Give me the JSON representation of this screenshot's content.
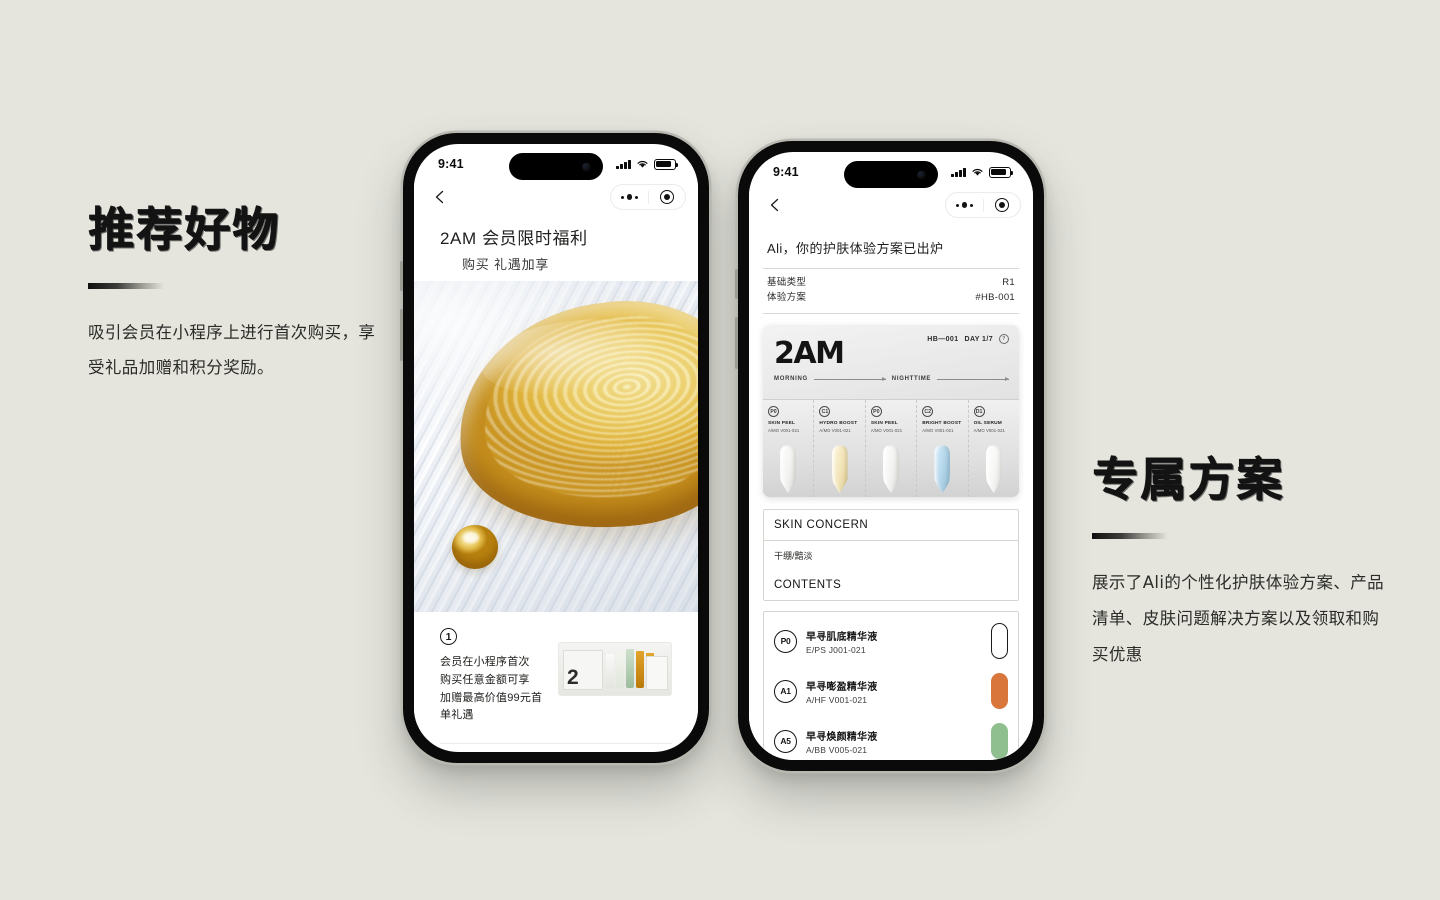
{
  "page": {
    "background_color": "#e5e5de",
    "accent_color": "#131313"
  },
  "left_block": {
    "heading": "推荐好物",
    "body": "吸引会员在小程序上进行首次购买，享受礼品加赠和积分奖励。"
  },
  "right_block": {
    "heading": "专属方案",
    "body": "展示了Ali的个性化护肤体验方案、产品清单、皮肤问题解决方案以及领取和购买优惠"
  },
  "phone1": {
    "status": {
      "time": "9:41",
      "signal_icon": "signal-bars-icon",
      "wifi_icon": "wifi-icon",
      "battery_icon": "battery-icon"
    },
    "nav": {
      "back_icon": "back-chevron-icon",
      "menu_icon": "more-dots-icon",
      "target_icon": "capsule-target-icon"
    },
    "header": {
      "title": "2AM 会员限时福利",
      "subtitle": "购买 礼遇加享"
    },
    "hero": {
      "name": "golden-oil-droplet-image"
    },
    "promo": {
      "badge": "1",
      "line1": "会员在小程序首次",
      "line2": "购买任意金额可享",
      "line3": "加赠最高价值99元首单礼遇",
      "thumb_name": "product-kit-thumbnail",
      "thumb_brand": "2AM"
    }
  },
  "phone2": {
    "status": {
      "time": "9:41",
      "signal_icon": "signal-bars-icon",
      "wifi_icon": "wifi-icon",
      "battery_icon": "battery-icon"
    },
    "nav": {
      "back_icon": "back-chevron-icon",
      "menu_icon": "more-dots-icon",
      "target_icon": "capsule-target-icon"
    },
    "title": "Ali，你的护肤体验方案已出炉",
    "meta": [
      {
        "label": "基础类型",
        "value": "R1"
      },
      {
        "label": "体验方案",
        "value": "#HB-001"
      }
    ],
    "kit": {
      "brand": "2AM",
      "code": "HB—001",
      "day": "DAY 1/7",
      "info_icon": "info-circle-icon",
      "phase_morning": "MORNING",
      "phase_night": "NIGHTTIME",
      "slots": [
        {
          "badge": "P0",
          "name": "SKIN PEEL",
          "code": "A/MO V001-021",
          "color": "#f7f7f5"
        },
        {
          "badge": "C1",
          "name": "HYDRO BOOST",
          "code": "A/MO V001-021",
          "color": "#f3e6bd"
        },
        {
          "badge": "P0",
          "name": "SKIN PEEL",
          "code": "A/MO V001-021",
          "color": "#f7f7f5"
        },
        {
          "badge": "C2",
          "name": "BRIGHT BOOST",
          "code": "A/MO V001-021",
          "color": "#b6d7ea"
        },
        {
          "badge": "D1",
          "name": "OIL SERUM",
          "code": "A/MO V001-021",
          "color": "#fbfbf9"
        }
      ]
    },
    "skin_concern": {
      "heading": "SKIN CONCERN",
      "value": "干绷/黯淡"
    },
    "contents": {
      "heading": "CONTENTS",
      "items": [
        {
          "badge": "P0",
          "name": "早寻肌底精华液",
          "code": "E/PS J001-021",
          "pill_color": "hollow"
        },
        {
          "badge": "A1",
          "name": "早寻嘭盈精华液",
          "code": "A/HF V001-021",
          "pill_color": "#d9763c"
        },
        {
          "badge": "A5",
          "name": "早寻焕颜精华液",
          "code": "A/BB V005-021",
          "pill_color": "#8fbf8f"
        }
      ]
    }
  }
}
